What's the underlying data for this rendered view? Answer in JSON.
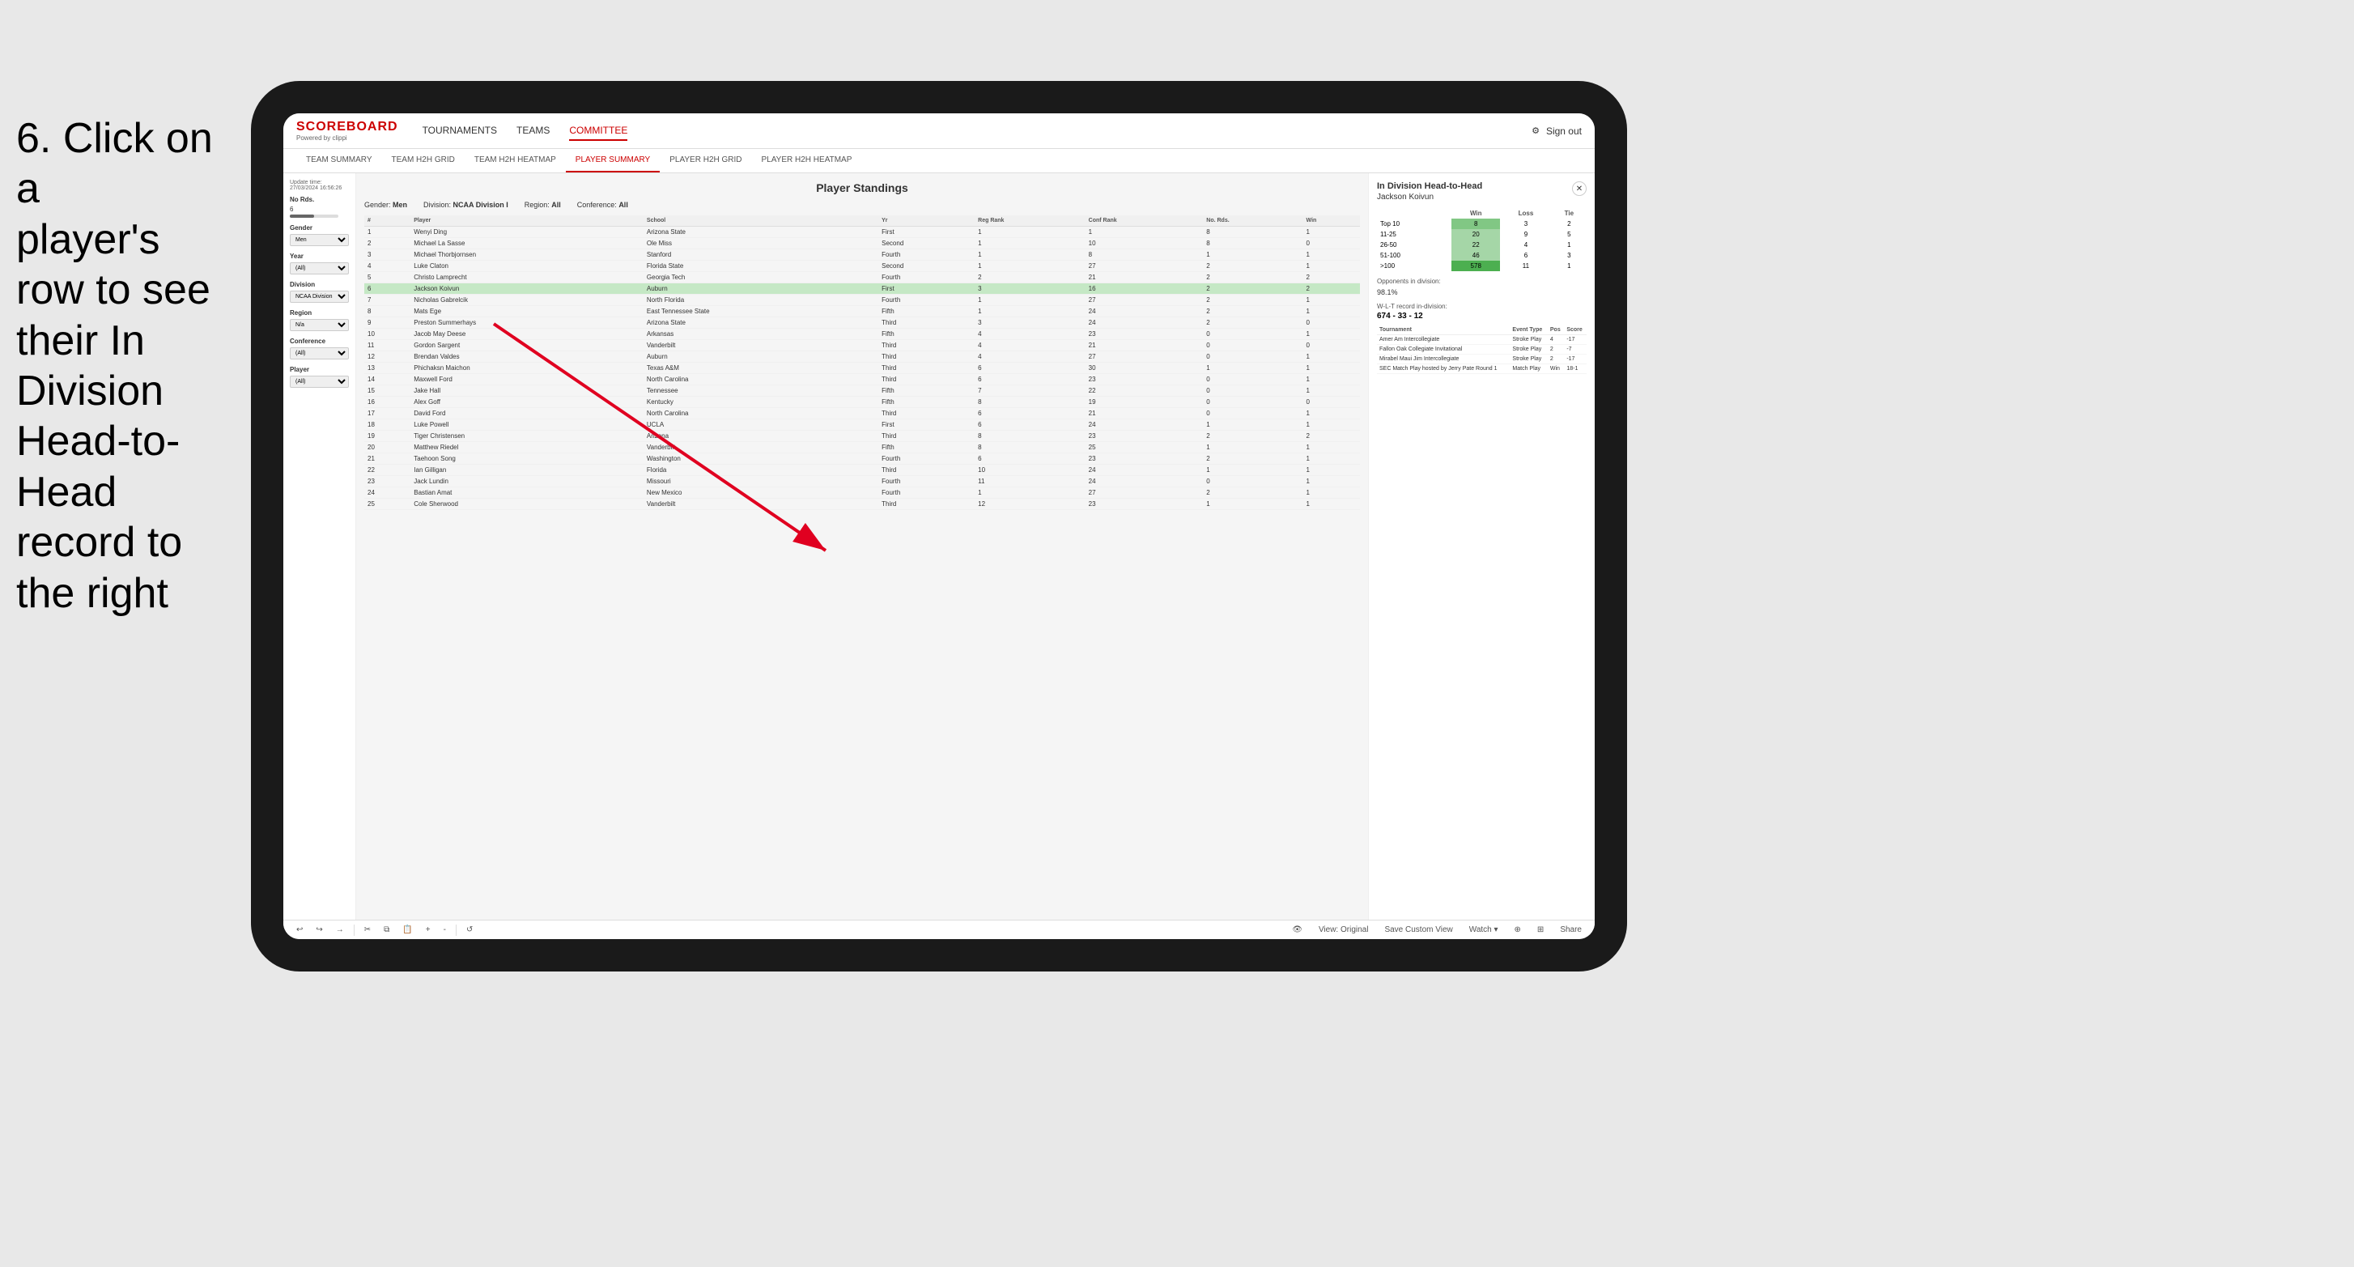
{
  "instruction": {
    "line1": "6. Click on a",
    "line2": "player's row to see",
    "line3": "their In Division",
    "line4": "Head-to-Head",
    "line5": "record to the right"
  },
  "nav": {
    "logo": "SCOREBOARD",
    "logo_sub": "Powered by clippi",
    "links": [
      "TOURNAMENTS",
      "TEAMS",
      "COMMITTEE"
    ],
    "sign_out": "Sign out"
  },
  "sub_nav": {
    "links": [
      "TEAM SUMMARY",
      "TEAM H2H GRID",
      "TEAM H2H HEATMAP",
      "PLAYER SUMMARY",
      "PLAYER H2H GRID",
      "PLAYER H2H HEATMAP"
    ],
    "active": "PLAYER SUMMARY"
  },
  "sidebar": {
    "update_label": "Update time:",
    "update_time": "27/03/2024 16:56:26",
    "no_rds_label": "No Rds.",
    "no_rds_value": "6",
    "gender_label": "Gender",
    "gender_value": "Men",
    "year_label": "Year",
    "year_value": "(All)",
    "division_label": "Division",
    "division_value": "NCAA Division I",
    "region_label": "Region",
    "region_value": "N/a",
    "conference_label": "Conference",
    "conference_value": "(All)",
    "player_label": "Player",
    "player_value": "(All)"
  },
  "panel": {
    "title": "Player Standings",
    "gender": "Men",
    "division": "NCAA Division I",
    "region": "All",
    "conference": "All"
  },
  "table": {
    "headers": [
      "#",
      "Player",
      "School",
      "Yr",
      "Reg Rank",
      "Conf Rank",
      "No. Rds.",
      "Win"
    ],
    "rows": [
      {
        "rank": 1,
        "player": "Wenyi Ding",
        "school": "Arizona State",
        "yr": "First",
        "reg": 1,
        "conf": 1,
        "rds": 8,
        "win": 1
      },
      {
        "rank": 2,
        "player": "Michael La Sasse",
        "school": "Ole Miss",
        "yr": "Second",
        "reg": 1,
        "conf": 10,
        "rds": 8,
        "win": 0
      },
      {
        "rank": 3,
        "player": "Michael Thorbjornsen",
        "school": "Stanford",
        "yr": "Fourth",
        "reg": 1,
        "conf": 8,
        "rds": 1,
        "win": 1
      },
      {
        "rank": 4,
        "player": "Luke Claton",
        "school": "Florida State",
        "yr": "Second",
        "reg": 1,
        "conf": 27,
        "rds": 2,
        "win": 1
      },
      {
        "rank": 5,
        "player": "Christo Lamprecht",
        "school": "Georgia Tech",
        "yr": "Fourth",
        "reg": 2,
        "conf": 21,
        "rds": 2,
        "win": 2
      },
      {
        "rank": 6,
        "player": "Jackson Koivun",
        "school": "Auburn",
        "yr": "First",
        "reg": 3,
        "conf": 16,
        "rds": 2,
        "win": 2
      },
      {
        "rank": 7,
        "player": "Nicholas Gabrelcik",
        "school": "North Florida",
        "yr": "Fourth",
        "reg": 1,
        "conf": 27,
        "rds": 2,
        "win": 1
      },
      {
        "rank": 8,
        "player": "Mats Ege",
        "school": "East Tennessee State",
        "yr": "Fifth",
        "reg": 1,
        "conf": 24,
        "rds": 2,
        "win": 1
      },
      {
        "rank": 9,
        "player": "Preston Summerhays",
        "school": "Arizona State",
        "yr": "Third",
        "reg": 3,
        "conf": 24,
        "rds": 2,
        "win": 0
      },
      {
        "rank": 10,
        "player": "Jacob May Deese",
        "school": "Arkansas",
        "yr": "Fifth",
        "reg": 4,
        "conf": 23,
        "rds": 0,
        "win": 1
      },
      {
        "rank": 11,
        "player": "Gordon Sargent",
        "school": "Vanderbilt",
        "yr": "Third",
        "reg": 4,
        "conf": 21,
        "rds": 0,
        "win": 0
      },
      {
        "rank": 12,
        "player": "Brendan Valdes",
        "school": "Auburn",
        "yr": "Third",
        "reg": 4,
        "conf": 27,
        "rds": 0,
        "win": 1
      },
      {
        "rank": 13,
        "player": "Phichaksn Maichon",
        "school": "Texas A&M",
        "yr": "Third",
        "reg": 6,
        "conf": 30,
        "rds": 1,
        "win": 1
      },
      {
        "rank": 14,
        "player": "Maxwell Ford",
        "school": "North Carolina",
        "yr": "Third",
        "reg": 6,
        "conf": 23,
        "rds": 0,
        "win": 1
      },
      {
        "rank": 15,
        "player": "Jake Hall",
        "school": "Tennessee",
        "yr": "Fifth",
        "reg": 7,
        "conf": 22,
        "rds": 0,
        "win": 1
      },
      {
        "rank": 16,
        "player": "Alex Goff",
        "school": "Kentucky",
        "yr": "Fifth",
        "reg": 8,
        "conf": 19,
        "rds": 0,
        "win": 0
      },
      {
        "rank": 17,
        "player": "David Ford",
        "school": "North Carolina",
        "yr": "Third",
        "reg": 6,
        "conf": 21,
        "rds": 0,
        "win": 1
      },
      {
        "rank": 18,
        "player": "Luke Powell",
        "school": "UCLA",
        "yr": "First",
        "reg": 6,
        "conf": 24,
        "rds": 1,
        "win": 1
      },
      {
        "rank": 19,
        "player": "Tiger Christensen",
        "school": "Arizona",
        "yr": "Third",
        "reg": 8,
        "conf": 23,
        "rds": 2,
        "win": 2
      },
      {
        "rank": 20,
        "player": "Matthew Riedel",
        "school": "Vanderbilt",
        "yr": "Fifth",
        "reg": 8,
        "conf": 25,
        "rds": 1,
        "win": 1
      },
      {
        "rank": 21,
        "player": "Taehoon Song",
        "school": "Washington",
        "yr": "Fourth",
        "reg": 6,
        "conf": 23,
        "rds": 2,
        "win": 1
      },
      {
        "rank": 22,
        "player": "Ian Gilligan",
        "school": "Florida",
        "yr": "Third",
        "reg": 10,
        "conf": 24,
        "rds": 1,
        "win": 1
      },
      {
        "rank": 23,
        "player": "Jack Lundin",
        "school": "Missouri",
        "yr": "Fourth",
        "reg": 11,
        "conf": 24,
        "rds": 0,
        "win": 1
      },
      {
        "rank": 24,
        "player": "Bastian Amat",
        "school": "New Mexico",
        "yr": "Fourth",
        "reg": 1,
        "conf": 27,
        "rds": 2,
        "win": 1
      },
      {
        "rank": 25,
        "player": "Cole Sherwood",
        "school": "Vanderbilt",
        "yr": "Third",
        "reg": 12,
        "conf": 23,
        "rds": 1,
        "win": 1
      }
    ]
  },
  "h2h": {
    "title": "In Division Head-to-Head",
    "player": "Jackson Koivun",
    "close_btn": "✕",
    "col_win": "Win",
    "col_loss": "Loss",
    "col_tie": "Tie",
    "rows": [
      {
        "range": "Top 10",
        "win": 8,
        "loss": 3,
        "tie": 2
      },
      {
        "range": "11-25",
        "win": 20,
        "loss": 9,
        "tie": 5
      },
      {
        "range": "26-50",
        "win": 22,
        "loss": 4,
        "tie": 1
      },
      {
        "range": "51-100",
        "win": 46,
        "loss": 6,
        "tie": 3
      },
      {
        "range": ">100",
        "win": 578,
        "loss": 11,
        "tie": 1
      }
    ],
    "opponents_label": "Opponents in division:",
    "wlt_label": "W-L-T record in-division:",
    "opponents_pct": "98.1%",
    "wlt_record": "674 - 33 - 12",
    "tournaments": [
      {
        "name": "Amer Am Intercollegiate",
        "type": "Stroke Play",
        "pos": 4,
        "score": -17
      },
      {
        "name": "Fallon Oak Collegiate Invitational",
        "type": "Stroke Play",
        "pos": 2,
        "score": -7
      },
      {
        "name": "Mirabel Maui Jim Intercollegiate",
        "type": "Stroke Play",
        "pos": 2,
        "score": -17
      },
      {
        "name": "SEC Match Play hosted by Jerry Pate Round 1",
        "type": "Match Play",
        "pos": "Win",
        "score": "18-1"
      }
    ],
    "tour_col_name": "Tournament",
    "tour_col_type": "Event Type",
    "tour_col_pos": "Pos",
    "tour_col_score": "Score"
  },
  "toolbar": {
    "undo": "↩",
    "redo": "↪",
    "forward": "→",
    "view_original": "View: Original",
    "save_custom": "Save Custom View",
    "watch": "Watch ▾",
    "share": "Share"
  }
}
